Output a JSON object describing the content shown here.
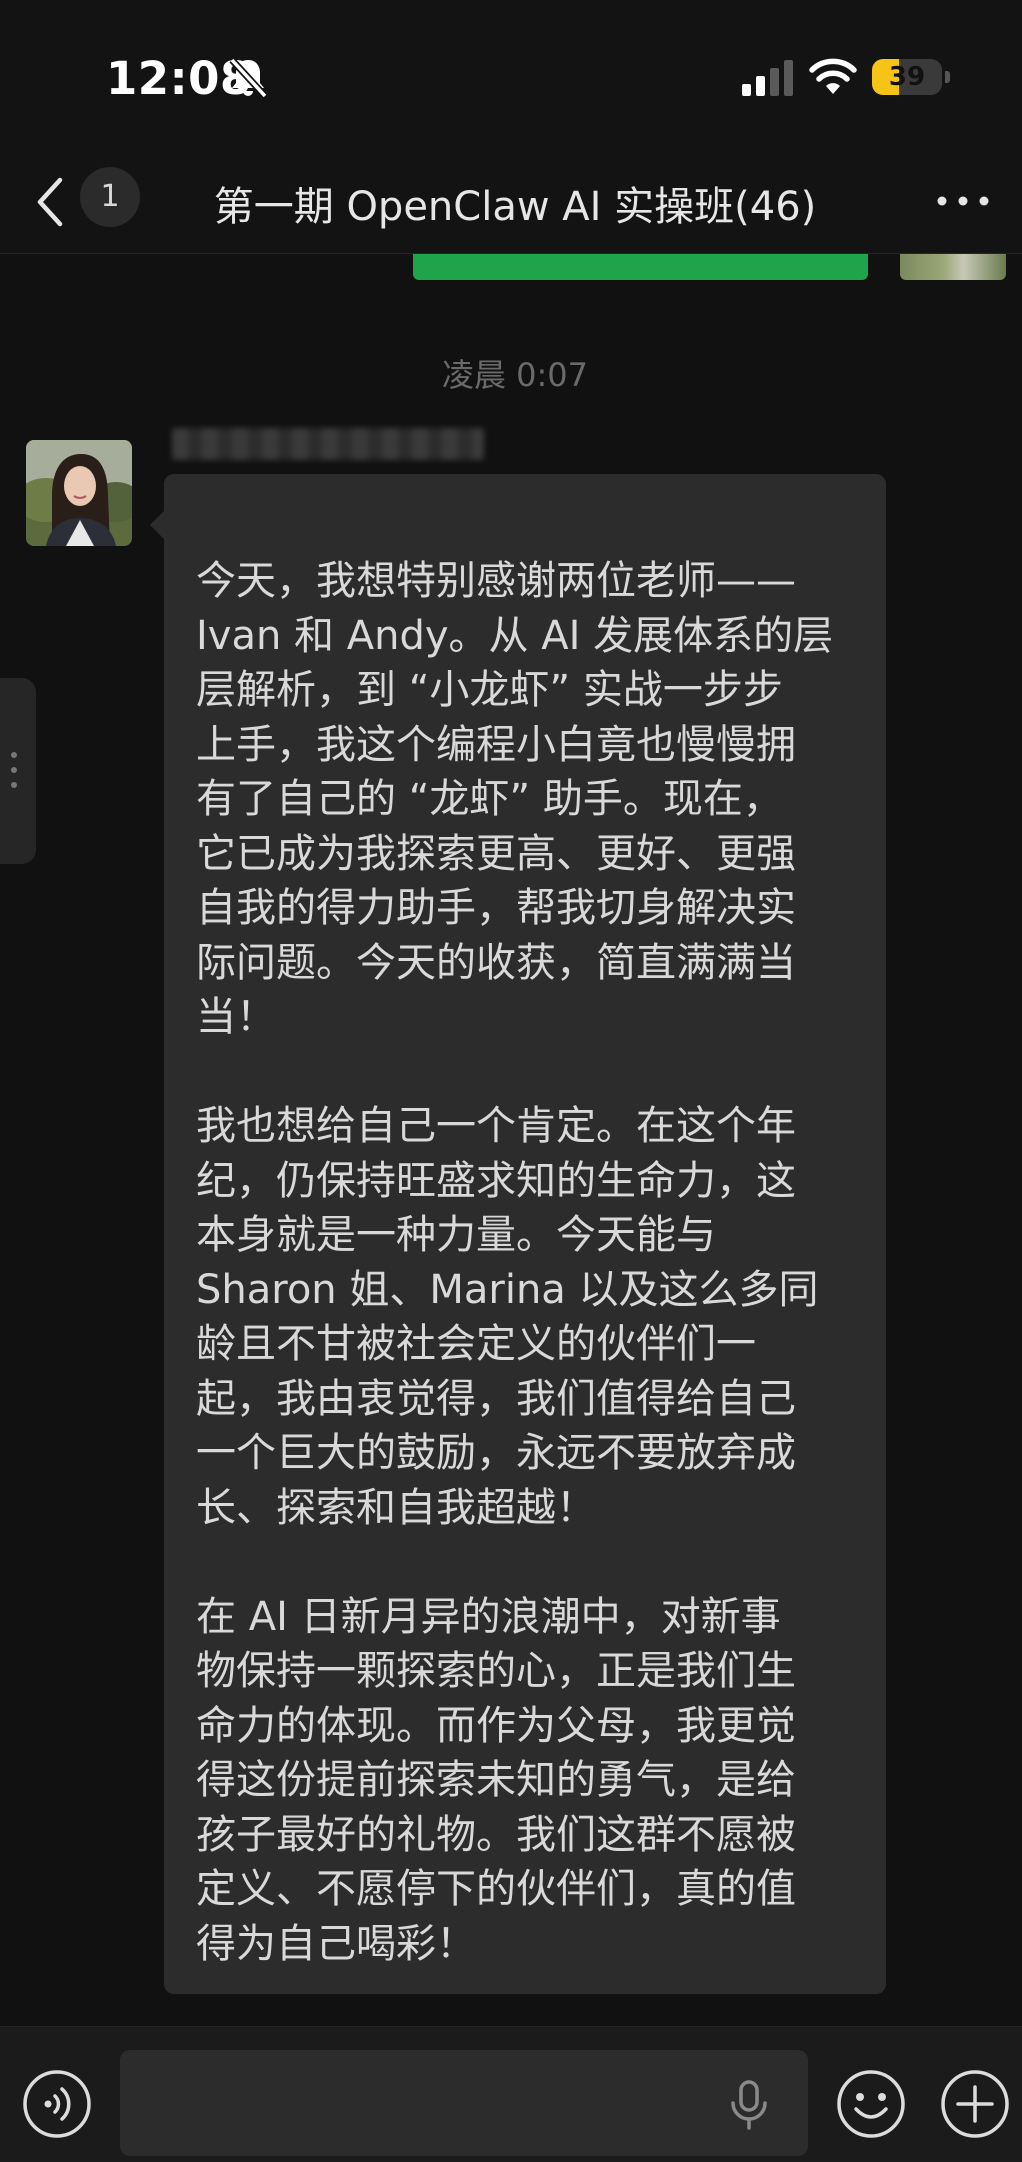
{
  "status_bar": {
    "time": "12:08",
    "battery_level": "39",
    "battery_fraction": 0.39,
    "icons": [
      "bell-slash-icon",
      "signal-icon",
      "wifi-icon",
      "battery-icon"
    ],
    "battery_color": "#f6c416"
  },
  "nav": {
    "back_icon": "chevron-left-icon",
    "unread_count": "1",
    "title": "第一期 OpenClaw AI 实操班(46)",
    "more_icon": "more-dots-icon"
  },
  "messages": {
    "timestamp": "凌晨 0:07",
    "sender_name": "",
    "text": "今天，我想特别感谢两位老师——\nIvan 和 Andy。从 AI 发展体系的层\n层解析，到 “小龙虾” 实战一步步\n上手，我这个编程小白竟也慢慢拥\n有了自己的 “龙虾” 助手。现在，\n它已成为我探索更高、更好、更强\n自我的得力助手，帮我切身解决实\n际问题。今天的收获，简直满满当\n当！\n\n我也想给自己一个肯定。在这个年\n纪，仍保持旺盛求知的生命力，这\n本身就是一种力量。今天能与\nSharon 姐、Marina 以及这么多同\n龄且不甘被社会定义的伙伴们一\n起，我由衷觉得，我们值得给自己\n一个巨大的鼓励，永远不要放弃成\n长、探索和自我超越！\n\n在 AI 日新月异的浪潮中，对新事\n物保持一颗探索的心，正是我们生\n命力的体现。而作为父母，我更觉\n得这份提前探索未知的勇气，是给\n孩子最好的礼物。我们这群不愿被\n定义、不愿停下的伙伴们，真的值\n得为自己喝彩！",
    "own_bubble_color": "#1ea44a",
    "bubble_color": "#2c2c2c"
  },
  "input_bar": {
    "placeholder": "",
    "icons": [
      "voice-icon",
      "microphone-icon",
      "emoji-icon",
      "plus-icon"
    ]
  }
}
